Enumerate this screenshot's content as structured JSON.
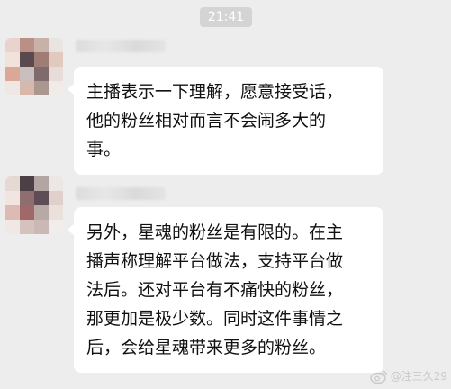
{
  "timestamp": "21:41",
  "messages": [
    {
      "lines": [
        "主播表示一下理解，愿意接受话，",
        "他的粉丝相对而言不会闹多大的",
        "事。"
      ]
    },
    {
      "lines": [
        "另外，星魂的粉丝是有限的。在主",
        "播声称理解平台做法，支持平台做",
        "法后。还对平台有不痛快的粉丝，",
        "那更加是极少数。同时这件事情之",
        "后，会给星魂带来更多的粉丝。"
      ]
    }
  ],
  "watermark": {
    "text": "@注三久29",
    "icon": "weibo-icon"
  },
  "colors": {
    "background": "#ededed",
    "bubble": "#ffffff",
    "timestamp_bg": "#d4d4d4"
  }
}
